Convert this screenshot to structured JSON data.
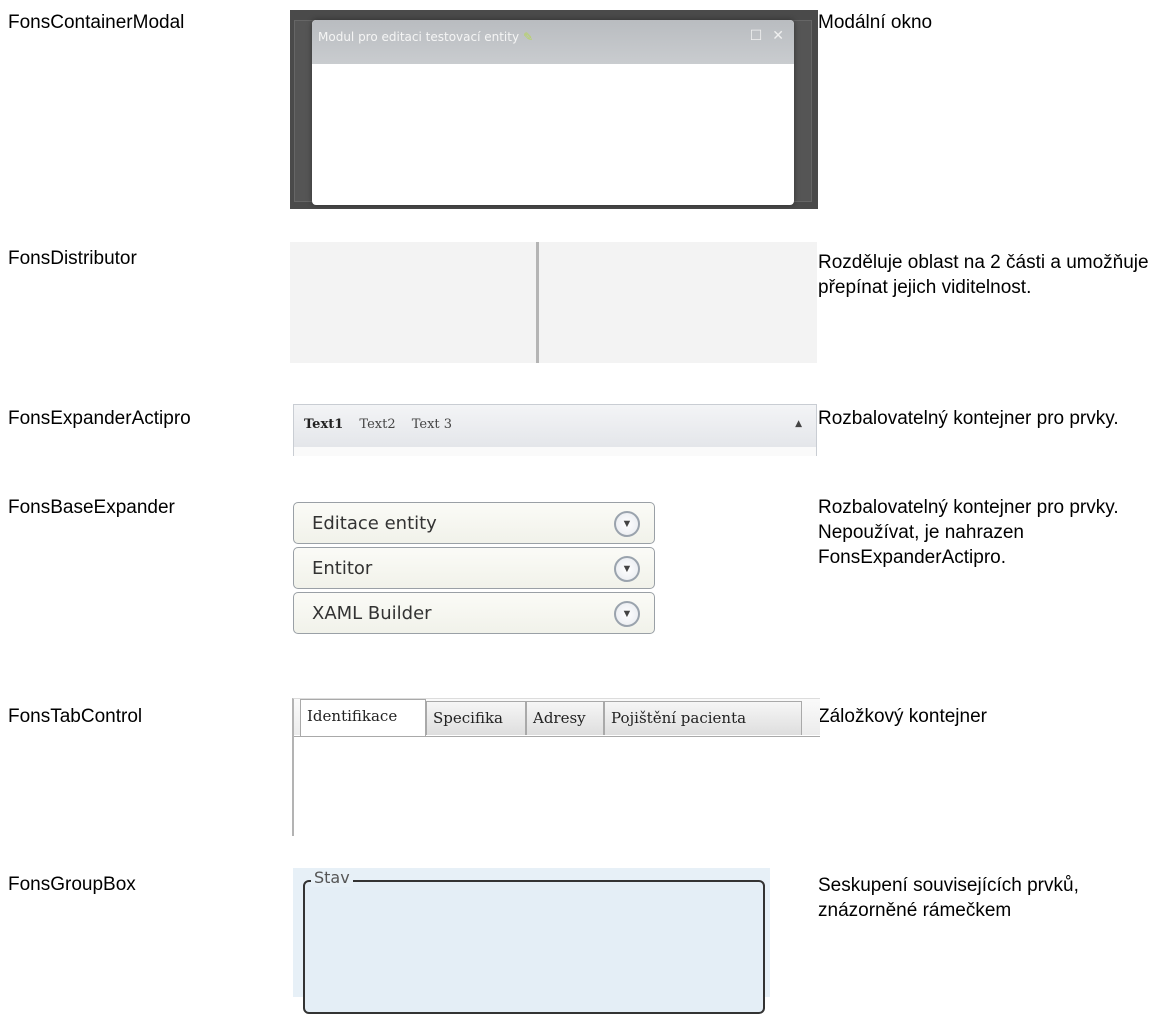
{
  "rows": [
    {
      "name": "FonsContainerModal",
      "description": "Modální okno"
    },
    {
      "name": "FonsDistributor",
      "description": "Rozděluje oblast na 2 části a umožňuje přepínat jejich viditelnost."
    },
    {
      "name": "FonsExpanderActipro",
      "description": "Rozbalovatelný kontejner pro prvky."
    },
    {
      "name": "FonsBaseExpander",
      "description": "Rozbalovatelný kontejner pro prvky. Nepoužívat, je nahrazen FonsExpanderActipro."
    },
    {
      "name": "FonsTabControl",
      "description": "Záložkový kontejner"
    },
    {
      "name": "FonsGroupBox",
      "description": "Seskupení souvisejících prvků, znázorněné rámečkem"
    }
  ],
  "modal": {
    "title": "Modul pro editaci testovací entity",
    "icons": [
      "pencil-icon",
      "maximize-icon",
      "close-icon"
    ]
  },
  "actipro": {
    "tabs": [
      "Text1",
      "Text2",
      "Text 3"
    ],
    "active_tab": "Text1",
    "icon": "collapse-up-icon"
  },
  "base_expanders": [
    "Editace entity",
    "Entitor",
    "XAML Builder"
  ],
  "tab_control": {
    "tabs": [
      "Identifikace",
      "Specifika",
      "Adresy",
      "Pojištění pacienta"
    ],
    "selected": "Identifikace"
  },
  "group_box": {
    "legend": "Stav"
  }
}
